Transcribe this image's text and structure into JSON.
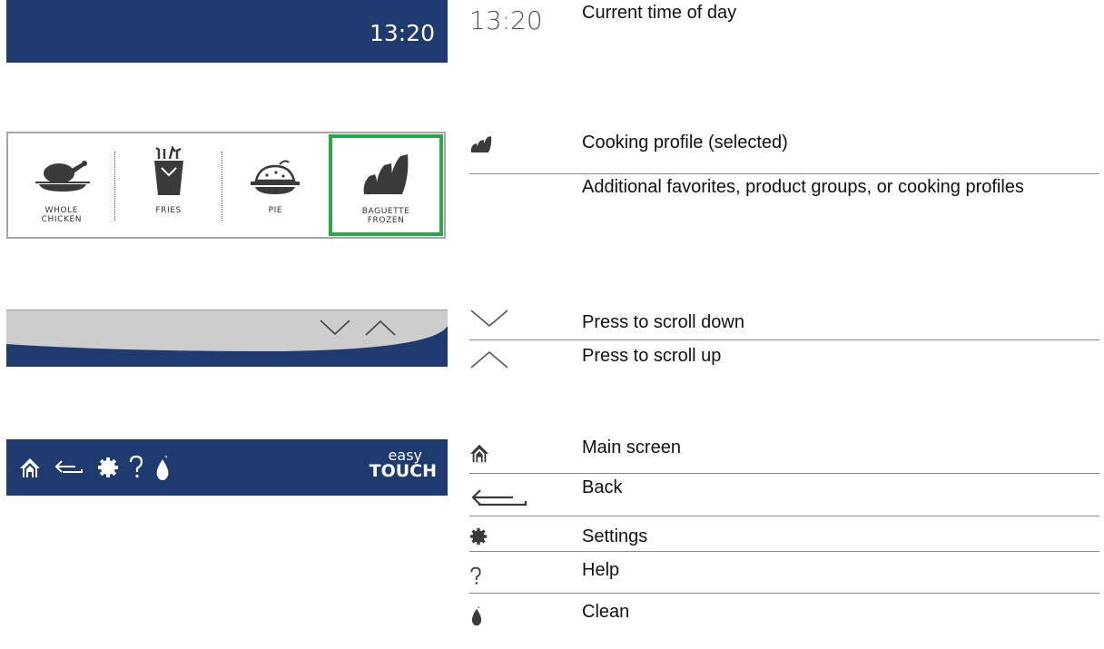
{
  "time_bar": {
    "clock": "13:20"
  },
  "profiles": [
    {
      "label": "WHOLE\nCHICKEN",
      "icon": "roast-chicken-icon",
      "selected": false
    },
    {
      "label": "FRIES",
      "icon": "fries-icon",
      "selected": false
    },
    {
      "label": "PIE",
      "icon": "pie-icon",
      "selected": false
    },
    {
      "label": "BAGUETTE\nFROZEN",
      "icon": "baguette-icon",
      "selected": true
    }
  ],
  "brand": {
    "line1": "easy",
    "line2": "TOUCH"
  },
  "legend": {
    "time": {
      "symbol": "13:20",
      "text": "Current time of day"
    },
    "profile_selected": {
      "icon": "baguette-icon",
      "text": "Cooking profile (selected)"
    },
    "additional": {
      "text": "Additional favorites, product groups, or cooking profiles"
    },
    "scroll_down": {
      "icon": "chevron-down-icon",
      "text": "Press to scroll down"
    },
    "scroll_up": {
      "icon": "chevron-up-icon",
      "text": "Press to scroll up"
    },
    "main_screen": {
      "icon": "home-icon",
      "text": "Main screen"
    },
    "back": {
      "icon": "back-arrow-icon",
      "text": "Back"
    },
    "settings": {
      "icon": "gear-icon",
      "text": "Settings"
    },
    "help": {
      "icon": "question-icon",
      "text": "Help"
    },
    "clean": {
      "icon": "clean-drop-icon",
      "text": "Clean"
    }
  },
  "colors": {
    "navy": "#1e3a6e",
    "selected_border": "#2aa845",
    "icon_gray": "#3a3a3a"
  }
}
